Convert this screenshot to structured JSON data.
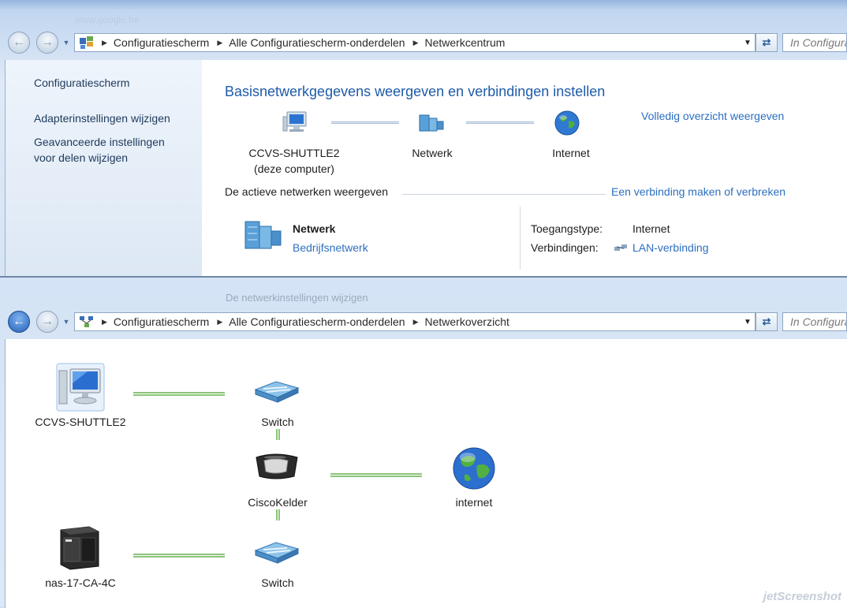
{
  "top_window": {
    "ghost_url": "www.google.be",
    "breadcrumbs": [
      "Configuratiescherm",
      "Alle Configuratiescherm-onderdelen",
      "Netwerkcentrum"
    ],
    "search_placeholder": "In Configuratiescherm zoeken",
    "sidebar": {
      "home": "Configuratiescherm",
      "links": [
        "Adapterinstellingen wijzigen",
        "Geavanceerde instellingen",
        "voor delen wijzigen"
      ]
    },
    "heading": "Basisnetwerkgegevens weergeven en verbindingen instellen",
    "full_map_link": "Volledig overzicht weergeven",
    "map": {
      "computer_name": "CCVS-SHUTTLE2",
      "computer_sub": "(deze computer)",
      "network": "Netwerk",
      "internet": "Internet"
    },
    "active_networks_label": "De actieve netwerken weergeven",
    "connect_link": "Een verbinding maken of verbreken",
    "active_network": {
      "name": "Netwerk",
      "type_link": "Bedrijfsnetwerk",
      "access_label": "Toegangstype:",
      "access_value": "Internet",
      "connections_label": "Verbindingen:",
      "connections_value": "LAN-verbinding"
    }
  },
  "bottom_window": {
    "ghost_text": "De netwerkinstellingen wijzigen",
    "breadcrumbs": [
      "Configuratiescherm",
      "Alle Configuratiescherm-onderdelen",
      "Netwerkoverzicht"
    ],
    "search_placeholder": "In Configuratiescherm zoeken",
    "nodes": {
      "pc": "CCVS-SHUTTLE2",
      "switch1": "Switch",
      "router": "CiscoKelder",
      "internet": "internet",
      "nas": "nas-17-CA-4C",
      "switch2": "Switch"
    }
  },
  "watermark": "jetScreenshot",
  "colors": {
    "link": "#2c6fc0",
    "heading": "#1e5ba8",
    "connector_green": "#8cc47a",
    "connector_blue": "#a8bcd6"
  }
}
